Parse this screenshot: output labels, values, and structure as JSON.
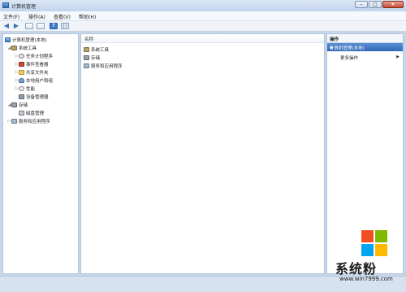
{
  "window": {
    "title": "计算机管理"
  },
  "menu": [
    "文件(F)",
    "操作(A)",
    "查看(V)",
    "帮助(H)"
  ],
  "tree": [
    {
      "label": "计算机管理(本地)",
      "expander": "",
      "icon": "computer-icon"
    },
    {
      "label": "系统工具",
      "expander": "◢",
      "icon": "tools-icon"
    },
    {
      "label": "任务计划程序",
      "expander": "▷",
      "icon": "clock-icon"
    },
    {
      "label": "事件查看器",
      "expander": "▷",
      "icon": "event-viewer-icon"
    },
    {
      "label": "共享文件夹",
      "expander": "▷",
      "icon": "shared-folder-icon"
    },
    {
      "label": "本地用户和组",
      "expander": "▷",
      "icon": "users-icon"
    },
    {
      "label": "性能",
      "expander": "▷",
      "icon": "performance-icon"
    },
    {
      "label": "设备管理器",
      "expander": "",
      "icon": "device-manager-icon"
    },
    {
      "label": "存储",
      "expander": "◢",
      "icon": "storage-icon"
    },
    {
      "label": "磁盘管理",
      "expander": "",
      "icon": "disk-icon"
    },
    {
      "label": "服务和应用程序",
      "expander": "▷",
      "icon": "services-icon"
    }
  ],
  "center": {
    "column_header": "名称",
    "items": [
      "系统工具",
      "存储",
      "服务和应用程序"
    ]
  },
  "actions": {
    "header": "操作",
    "selected": "计算机管理(本地)",
    "more": "更多操作"
  },
  "watermark": {
    "text": "系统粉",
    "url": "www.win7999.com",
    "colors": [
      "#f25022",
      "#7fba00",
      "#00a4ef",
      "#ffb900"
    ]
  }
}
